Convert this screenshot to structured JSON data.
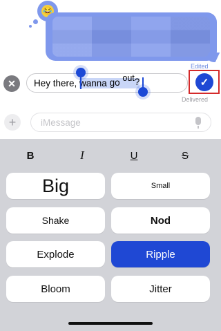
{
  "conversation": {
    "previous_label": "Edited",
    "tapback_emoji": "😂"
  },
  "editor": {
    "text_before": "Hey there, ",
    "selected_word": "wanna",
    "text_go": "go",
    "text_out": "out",
    "text_q": "?",
    "cancel_symbol": "✕",
    "confirm_symbol": "✓",
    "delivered_label": "Delivered"
  },
  "compose": {
    "plus_symbol": "+",
    "placeholder": "iMessage"
  },
  "format": {
    "bold": "B",
    "italic": "I",
    "underline": "U",
    "strike": "S"
  },
  "effects": {
    "big": "Big",
    "small": "Small",
    "shake": "Shake",
    "nod": "Nod",
    "explode": "Explode",
    "ripple": "Ripple",
    "bloom": "Bloom",
    "jitter": "Jitter",
    "selected": "Ripple"
  },
  "colors": {
    "accent": "#1f48d4",
    "bubble": "#7f98ec",
    "panel": "#d2d3d8",
    "highlight_box": "#d42a2a"
  }
}
